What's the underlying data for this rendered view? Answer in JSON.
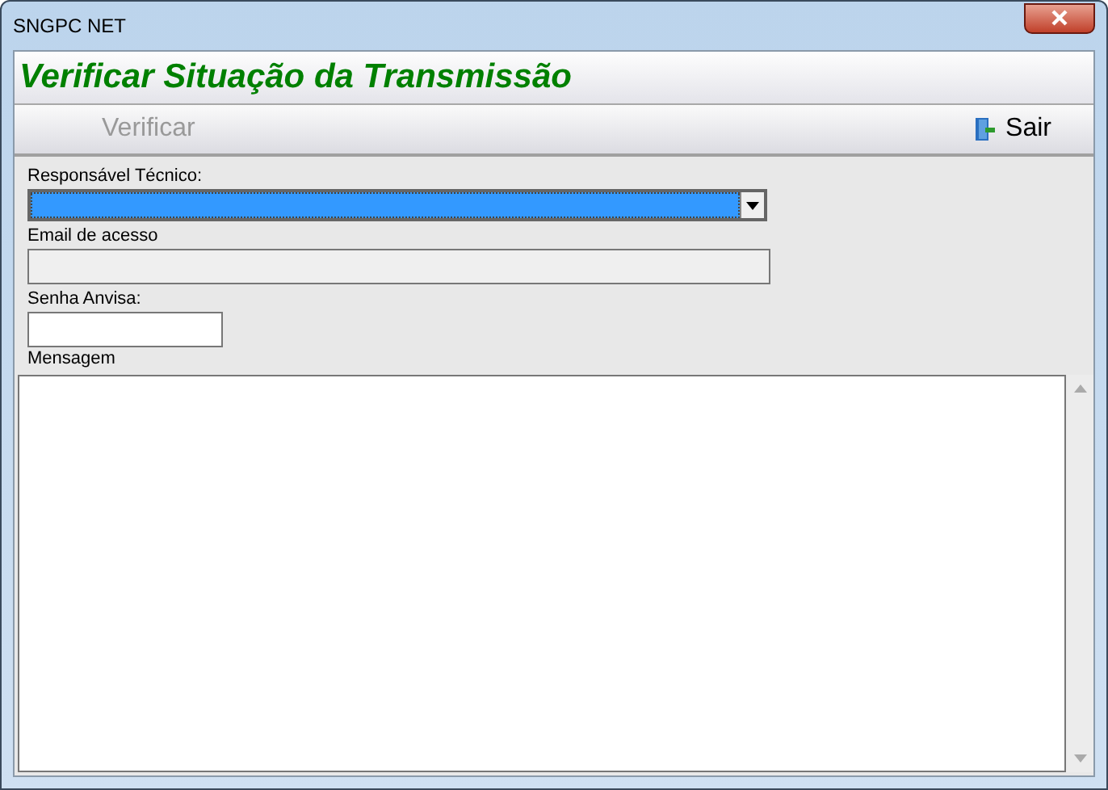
{
  "window": {
    "title": "SNGPC NET"
  },
  "header": {
    "title": "Verificar Situação da Transmissão"
  },
  "toolbar": [
    {
      "label": "Verificar",
      "kind": "action",
      "disabled": true
    },
    {
      "label": "Sair",
      "kind": "exit",
      "disabled": false
    }
  ],
  "form": {
    "fields": [
      {
        "label": "Responsável Técnico:",
        "kind": "combo",
        "disabled": false,
        "selected": true
      },
      {
        "label": "Email de acesso",
        "kind": "text",
        "disabled": true
      },
      {
        "label": "Senha Anvisa:",
        "kind": "short",
        "disabled": false
      }
    ],
    "message": {
      "label": "Mensagem"
    }
  }
}
